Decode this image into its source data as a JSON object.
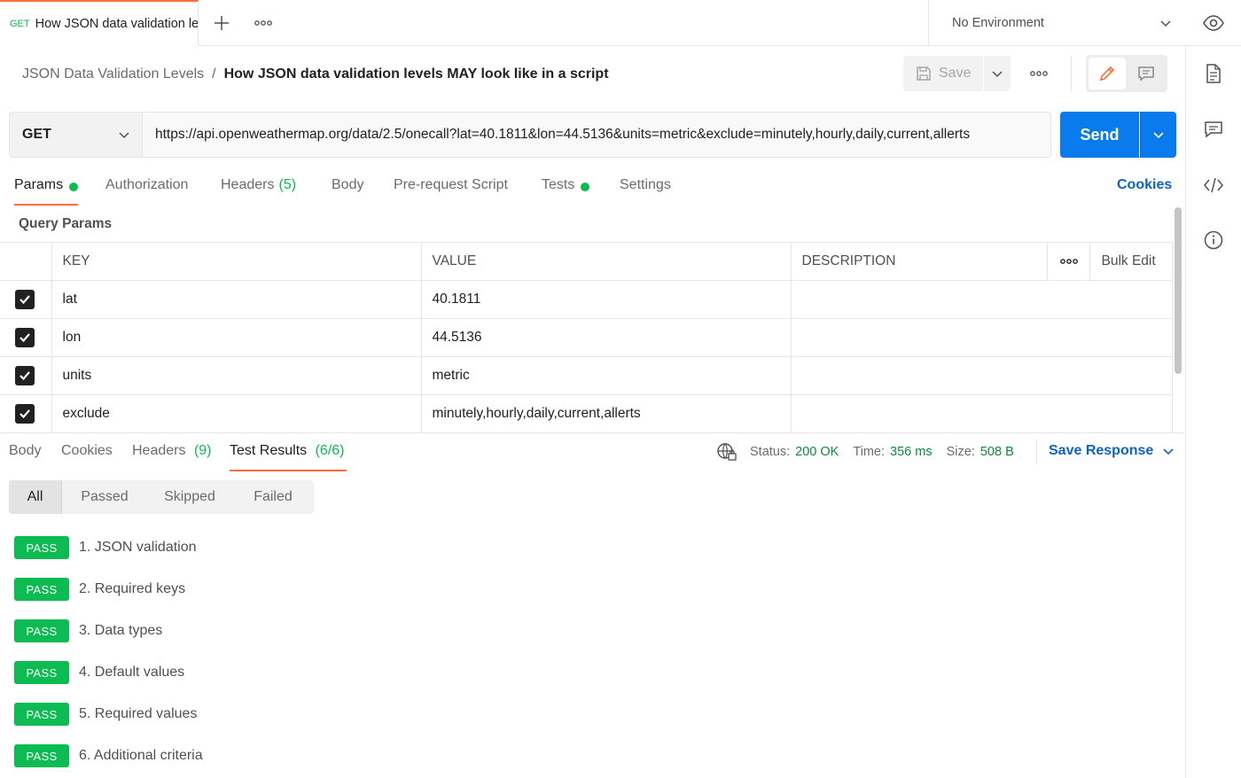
{
  "tab": {
    "method": "GET",
    "title": "How JSON data validation levels MAY look like in a script"
  },
  "environment": {
    "label": "No Environment"
  },
  "breadcrumb": {
    "collection": "JSON Data Validation Levels",
    "separator": "/",
    "title": "How JSON data validation levels MAY look like in a script"
  },
  "toolbar": {
    "save_label": "Save"
  },
  "request": {
    "method": "GET",
    "url": "https://api.openweathermap.org/data/2.5/onecall?lat=40.1811&lon=44.5136&units=metric&exclude=minutely,hourly,daily,current,allerts",
    "send_label": "Send"
  },
  "request_tabs": {
    "params": "Params",
    "authorization": "Authorization",
    "headers": "Headers",
    "headers_count": "(5)",
    "body": "Body",
    "prerequest": "Pre-request Script",
    "tests": "Tests",
    "settings": "Settings",
    "cookies": "Cookies"
  },
  "query_params": {
    "title": "Query Params",
    "headers": {
      "key": "KEY",
      "value": "VALUE",
      "description": "DESCRIPTION",
      "bulk_edit": "Bulk Edit"
    },
    "rows": [
      {
        "key": "lat",
        "value": "40.1811",
        "description": "",
        "checked": true
      },
      {
        "key": "lon",
        "value": "44.5136",
        "description": "",
        "checked": true
      },
      {
        "key": "units",
        "value": "metric",
        "description": "",
        "checked": true
      },
      {
        "key": "exclude",
        "value": "minutely,hourly,daily,current,allerts",
        "description": "",
        "checked": true
      }
    ]
  },
  "response_tabs": {
    "body": "Body",
    "cookies": "Cookies",
    "headers": "Headers",
    "headers_count": "(9)",
    "test_results": "Test Results",
    "test_results_count": "(6/6)"
  },
  "response_meta": {
    "status_label": "Status:",
    "status_value": "200 OK",
    "time_label": "Time:",
    "time_value": "356 ms",
    "size_label": "Size:",
    "size_value": "508 B",
    "save_response": "Save Response"
  },
  "filters": [
    "All",
    "Passed",
    "Skipped",
    "Failed"
  ],
  "results": [
    {
      "status": "PASS",
      "label": "1. JSON validation"
    },
    {
      "status": "PASS",
      "label": "2. Required keys"
    },
    {
      "status": "PASS",
      "label": "3. Data types"
    },
    {
      "status": "PASS",
      "label": "4. Default values"
    },
    {
      "status": "PASS",
      "label": "5. Required values"
    },
    {
      "status": "PASS",
      "label": "6. Additional criteria"
    }
  ],
  "colors": {
    "accent": "#ff6c37",
    "primary": "#097bed",
    "success": "#0cbb52",
    "link": "#0b63c5"
  },
  "icons": [
    "plus-icon",
    "more-icon",
    "chevron-down-icon",
    "eye-icon",
    "save-icon",
    "pencil-icon",
    "comment-icon",
    "document-icon",
    "code-icon",
    "info-icon",
    "globe-lock-icon",
    "check-icon"
  ]
}
